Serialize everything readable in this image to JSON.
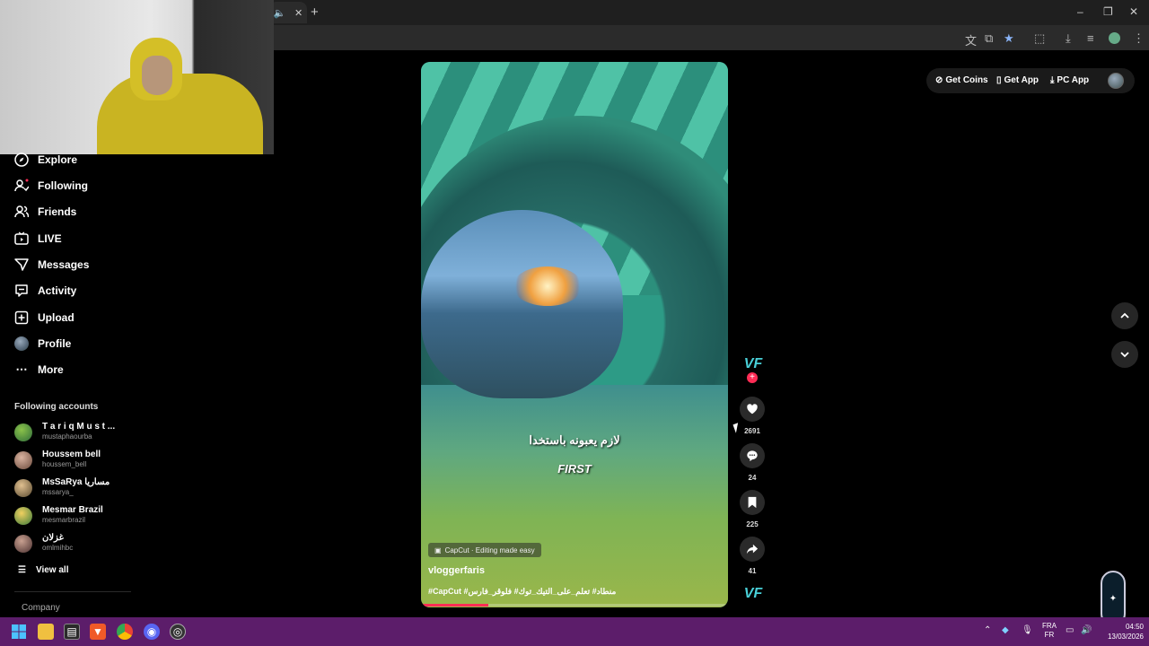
{
  "browser": {
    "tab_icons": [
      "speaker-icon",
      "close-icon"
    ],
    "new_tab_label": "+",
    "window_controls": [
      "–",
      "❐",
      "✕"
    ]
  },
  "sidebar": {
    "nav": [
      {
        "label": "Explore",
        "icon": "compass-icon"
      },
      {
        "label": "Following",
        "icon": "following-icon"
      },
      {
        "label": "Friends",
        "icon": "friends-icon"
      },
      {
        "label": "LIVE",
        "icon": "live-icon"
      },
      {
        "label": "Messages",
        "icon": "messages-icon"
      },
      {
        "label": "Activity",
        "icon": "activity-icon"
      },
      {
        "label": "Upload",
        "icon": "upload-icon"
      },
      {
        "label": "Profile",
        "icon": "profile-avatar"
      },
      {
        "label": "More",
        "icon": "more-icon"
      }
    ],
    "following_title": "Following accounts",
    "accounts": [
      {
        "name": "T a r i q  M u s t ...",
        "handle": "mustaphaourba"
      },
      {
        "name": "Houssem bell",
        "handle": "houssem_bell"
      },
      {
        "name": "MsSaRya مساريا",
        "handle": "mssarya_"
      },
      {
        "name": "Mesmar Brazil",
        "handle": "mesmarbrazil"
      },
      {
        "name": "غزلان",
        "handle": "omlmihbc"
      }
    ],
    "view_all": "View all",
    "company": "Company"
  },
  "header": {
    "get_coins": "Get Coins",
    "get_app": "Get App",
    "pc_app": "PC App"
  },
  "video": {
    "subtitle_ar": "لازم يعبونه باستخدا",
    "subtitle_en": "FIRST",
    "capcut_label": "CapCut · Editing made easy",
    "author": "vloggerfaris",
    "description": "#CapCut #منطاد# تعلم_على_التيك_توك# فلوقر_فارس",
    "progress": 0.22
  },
  "actions": {
    "likes": "2691",
    "comments": "24",
    "saves": "225",
    "shares": "41"
  },
  "taskbar": {
    "lang_top": "FRA",
    "lang_bottom": "FR",
    "time": "04:50",
    "date": "13/03/2026"
  }
}
